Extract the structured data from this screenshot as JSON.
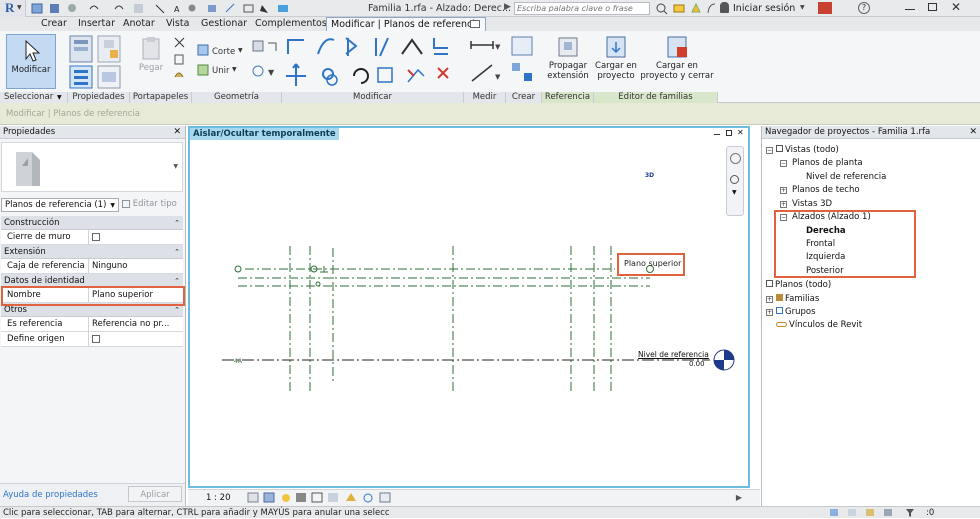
{
  "titlebar": {
    "app_letter": "R",
    "document_title": "Familia 1.rfa - Alzado: Derec...",
    "search_placeholder": "Escriba palabra clave o frase",
    "signin": "Iniciar sesión"
  },
  "ribbon_tabs": [
    "Crear",
    "Insertar",
    "Anotar",
    "Vista",
    "Gestionar",
    "Complementos",
    "Modificar | Planos de referencia"
  ],
  "ribbon": {
    "modify_button": "Modificar",
    "paste_button": "Pegar",
    "cut_label": "Corte",
    "join_label": "Unir",
    "propagate_button": "Propagar extensión",
    "load_button": "Cargar en proyecto",
    "load_close_button": "Cargar en proyecto y cerrar",
    "panels": [
      "Seleccionar",
      "Propiedades",
      "Portapapeles",
      "Geometría",
      "Modificar",
      "Medir",
      "Crear",
      "Referencia",
      "Editor de familias"
    ]
  },
  "context_bar": "Modificar | Planos de referencia",
  "properties": {
    "header": "Propiedades",
    "type_selector": "Planos de referencia (1)",
    "edit_type": "Editar tipo",
    "categories": {
      "construccion": "Construcción",
      "extension": "Extensión",
      "identidad": "Datos de identidad",
      "otros": "Otros"
    },
    "rows": {
      "cierre_label": "Cierre de muro",
      "caja_label": "Caja de referencia",
      "caja_value": "Ninguno",
      "nombre_label": "Nombre",
      "nombre_value": "Plano superior",
      "esref_label": "Es referencia",
      "esref_value": "Referencia no pr...",
      "origen_label": "Define origen"
    },
    "help_link": "Ayuda de propiedades",
    "apply_button": "Aplicar"
  },
  "canvas": {
    "temp_banner": "Aislar/Ocultar temporalmente",
    "label_3d": "3D",
    "plane_label": "Plano superior",
    "level_name": "Nivel de referencia",
    "level_value": "0.00",
    "scale": "1 : 20"
  },
  "navigator": {
    "header": "Navegador de proyectos - Familia 1.rfa",
    "views_all": "Vistas (todo)",
    "floor_plans": "Planos de planta",
    "ref_level": "Nivel de referencia",
    "ceiling_plans": "Planos de techo",
    "views_3d": "Vistas 3D",
    "elevations": "Alzados (Alzado 1)",
    "right": "Derecha",
    "front": "Frontal",
    "left": "Izquierda",
    "back": "Posterior",
    "sheets": "Planos (todo)",
    "families": "Familias",
    "groups": "Grupos",
    "revit_links": "Vínculos de Revit"
  },
  "status": {
    "text": "Clic para seleccionar, TAB para alternar, CTRL para añadir y MAYÚS para anular una selecc",
    "filter_count": ":0"
  },
  "colors": {
    "accent": "#2e75c8",
    "highlight": "#e0633f",
    "canvas_border": "#6dbde0",
    "ref_plane": "#2f6f3a"
  }
}
